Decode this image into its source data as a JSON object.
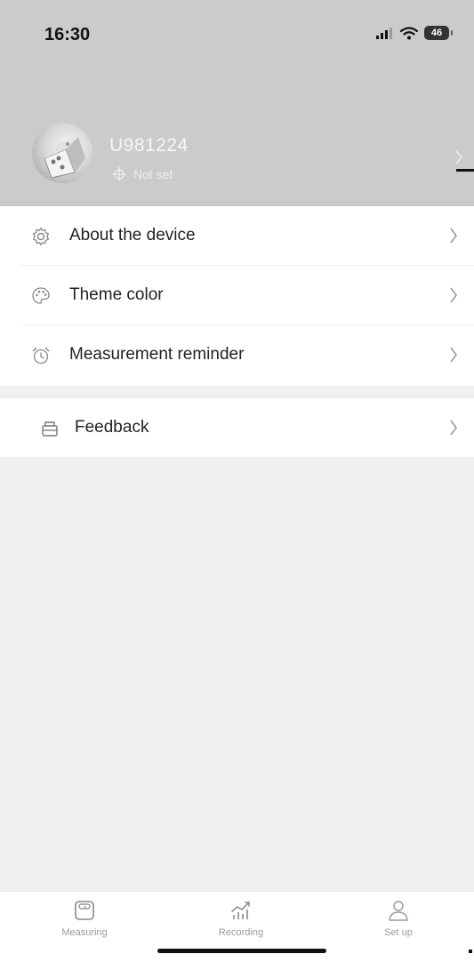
{
  "status_bar": {
    "time": "16:30",
    "battery": "46"
  },
  "profile": {
    "username": "U981224",
    "location": "Not set"
  },
  "menu": {
    "items": [
      {
        "label": "About the device",
        "icon": "gear-icon"
      },
      {
        "label": "Theme color",
        "icon": "palette-icon"
      },
      {
        "label": "Measurement reminder",
        "icon": "alarm-clock-icon"
      }
    ],
    "feedback": {
      "label": "Feedback",
      "icon": "feedback-icon"
    }
  },
  "tabbar": {
    "active": "Set up",
    "tabs": [
      {
        "label": "Measuring",
        "icon": "scale-icon"
      },
      {
        "label": "Recording",
        "icon": "chart-icon"
      },
      {
        "label": "Set up",
        "icon": "user-icon"
      }
    ]
  },
  "colors": {
    "header_bg": "#cbcbcb",
    "page_bg": "#f0f0f0",
    "card_bg": "#ffffff",
    "muted_text": "#9a9a9a"
  }
}
